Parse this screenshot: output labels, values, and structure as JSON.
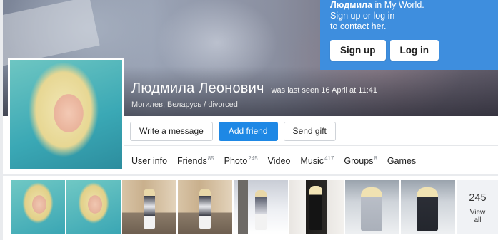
{
  "login_promo": {
    "line1_bold": "Людмила",
    "line1_rest": " in My World.",
    "line2": "Sign up or log in",
    "line3": "to contact her.",
    "signup_label": "Sign up",
    "login_label": "Log in"
  },
  "profile": {
    "name": "Людмила Леонович",
    "last_seen": "was last seen 16 April at 11:41",
    "location": "Могилев, Беларусь / divorced"
  },
  "actions": {
    "write_message": "Write a message",
    "add_friend": "Add friend",
    "send_gift": "Send gift"
  },
  "tabs": [
    {
      "label": "User info",
      "count": ""
    },
    {
      "label": "Friends",
      "count": "85"
    },
    {
      "label": "Photo",
      "count": "245"
    },
    {
      "label": "Video",
      "count": ""
    },
    {
      "label": "Music",
      "count": "417"
    },
    {
      "label": "Groups",
      "count": "8"
    },
    {
      "label": "Games",
      "count": ""
    }
  ],
  "photos": {
    "total": "245",
    "view_all_label": "View all"
  },
  "colors": {
    "accent": "#1e88e5",
    "promo_bg": "#3e8ede"
  }
}
